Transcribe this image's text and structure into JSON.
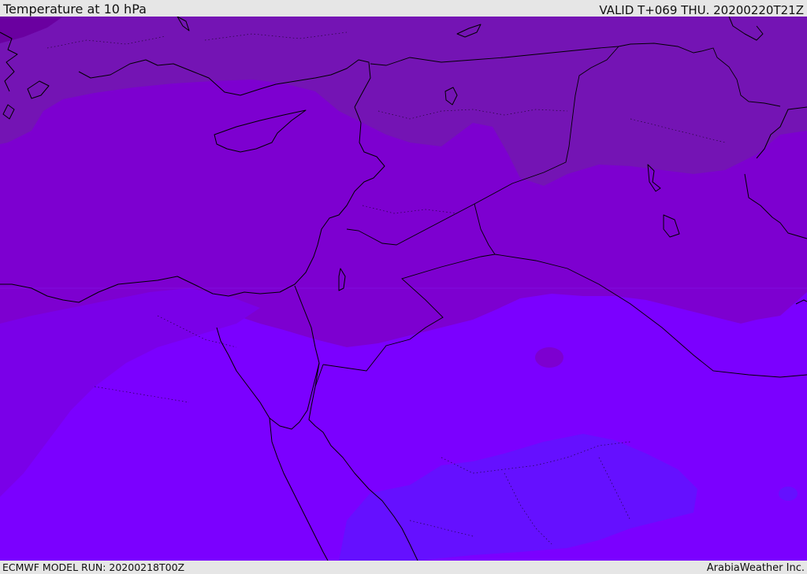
{
  "header": {
    "title": "Temperature at 10 hPa",
    "valid": "VALID T+069 THU. 20200220T21Z"
  },
  "footer": {
    "model_run": "ECMWF MODEL RUN: 20200218T00Z",
    "credit": "ArabiaWeather Inc."
  },
  "map": {
    "field": "temperature",
    "level": "10 hPa",
    "colors": {
      "coldest": "#6a00a0",
      "cold": "#7414b4",
      "mid": "#7d00d0",
      "mid_light": "#7a00e8",
      "base": "#7b00ff",
      "warm": "#6510ff",
      "coast": "#000000"
    }
  }
}
